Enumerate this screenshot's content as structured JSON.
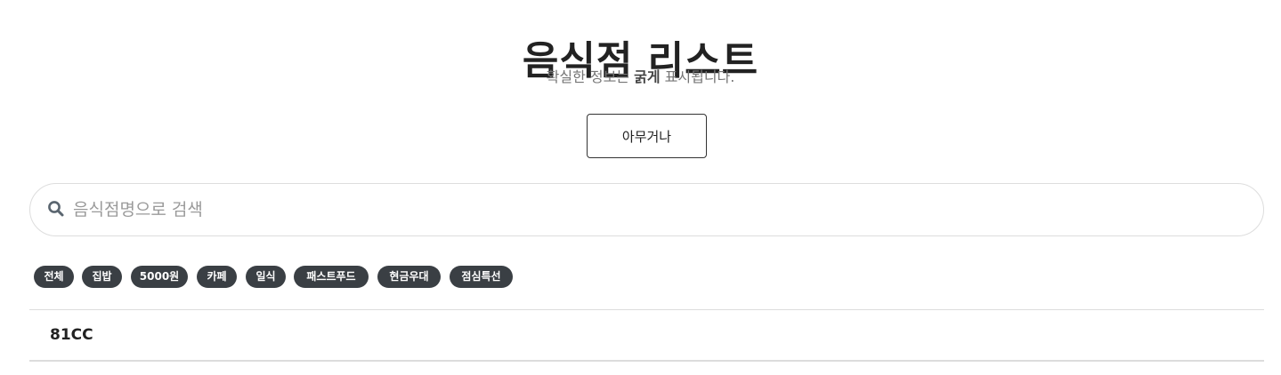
{
  "header": {
    "title": "음식점 리스트",
    "subtitle_prefix": "확실한 정보는 ",
    "subtitle_bold": "굵게",
    "subtitle_suffix": " 표시됩니다."
  },
  "random_button": {
    "label": "아무거나"
  },
  "search": {
    "icon": "search-icon",
    "placeholder": "음식점명으로 검색",
    "value": ""
  },
  "filters": {
    "chips": [
      {
        "label": "전체"
      },
      {
        "label": "집밥"
      },
      {
        "label": "5000원"
      },
      {
        "label": "카페"
      },
      {
        "label": "일식"
      },
      {
        "label": "패스트푸드"
      },
      {
        "label": "현금우대"
      },
      {
        "label": "점심특선"
      }
    ]
  },
  "restaurants": [
    {
      "name": "81CC"
    }
  ],
  "colors": {
    "chip_background": "#3a3f44",
    "chip_text": "#ffffff",
    "title": "#222222",
    "subtitle": "#757575"
  }
}
